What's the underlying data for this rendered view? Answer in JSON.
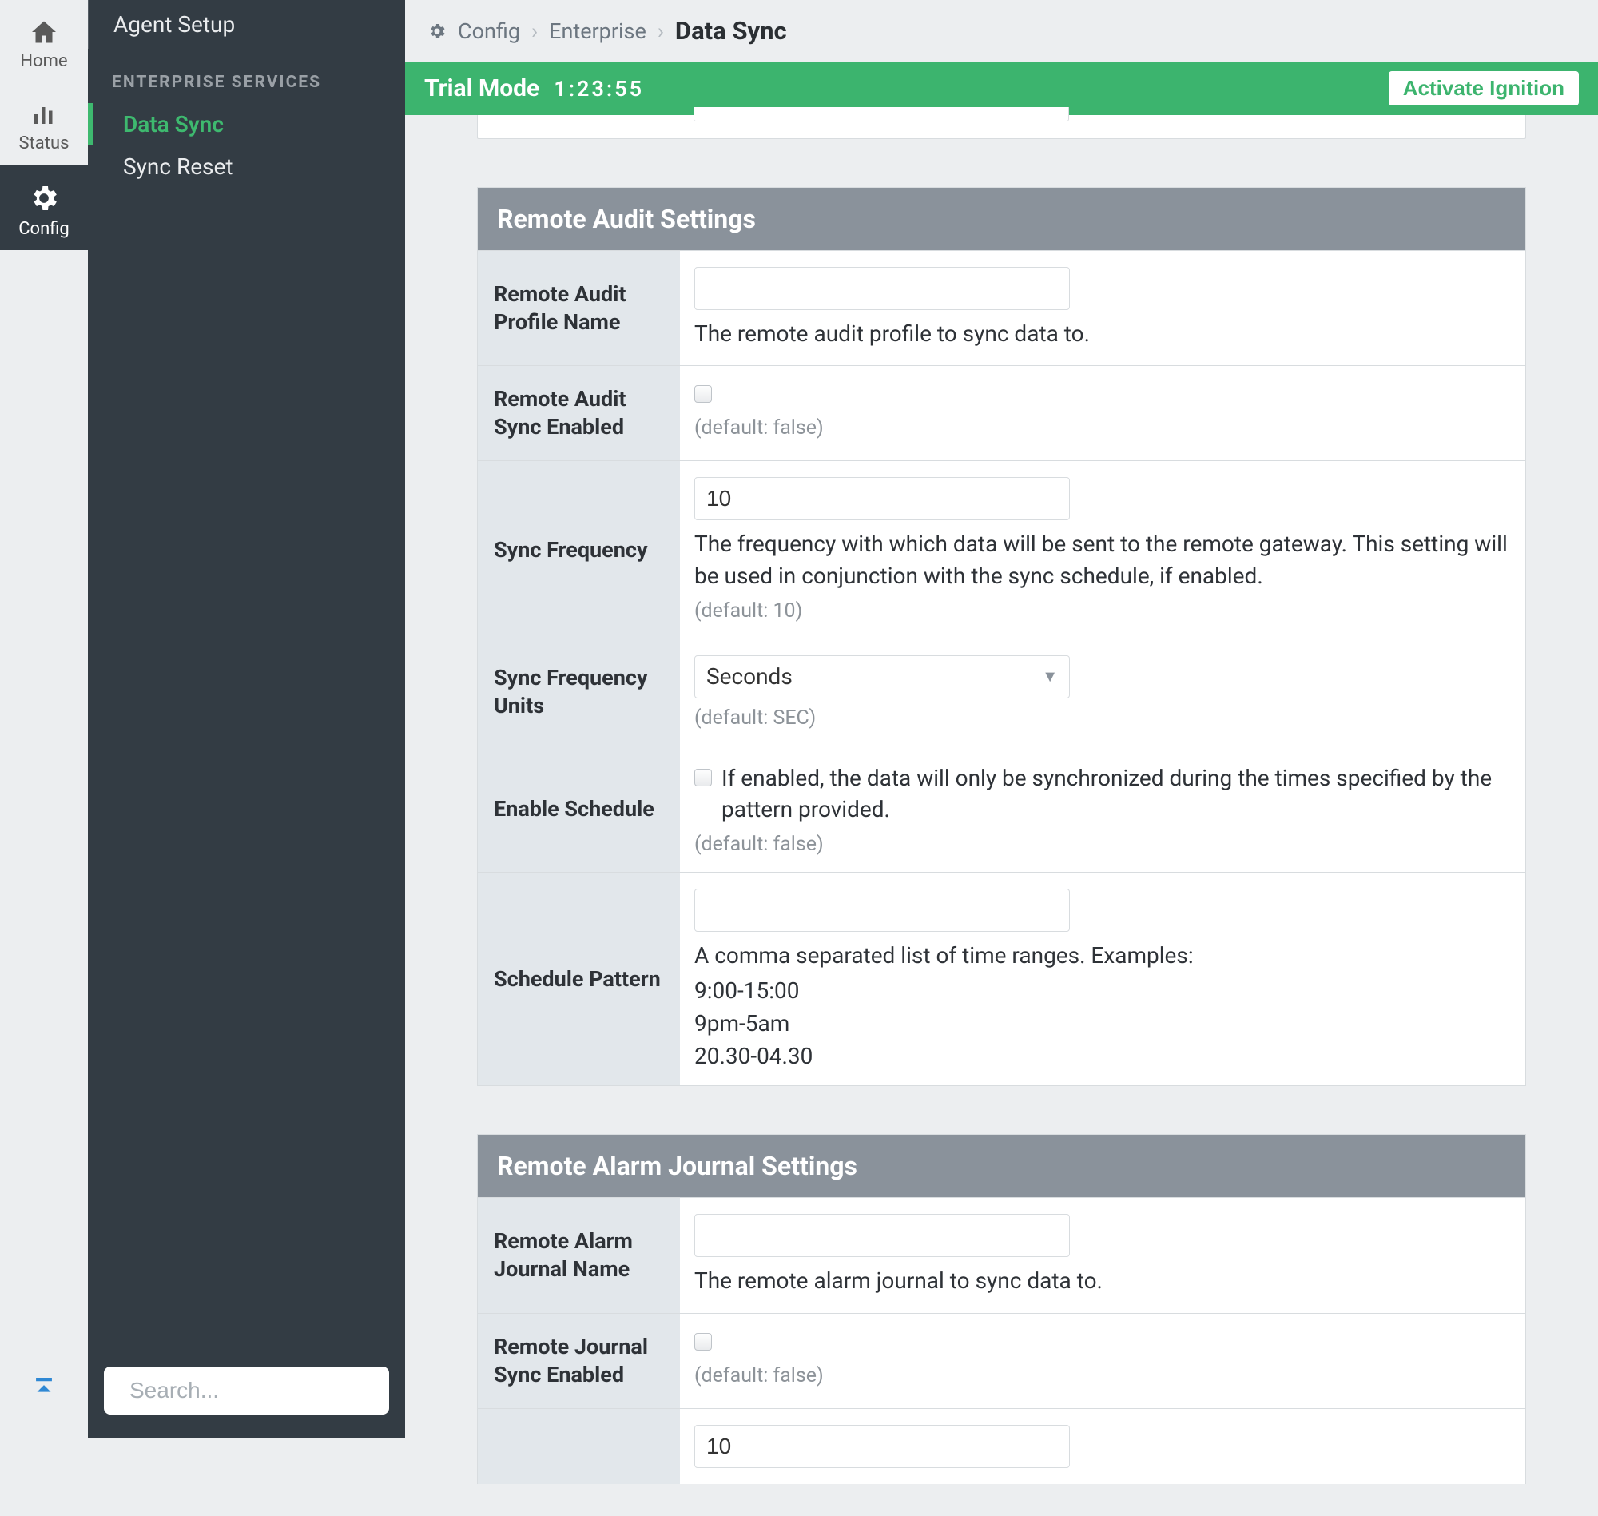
{
  "rail": {
    "home": "Home",
    "status": "Status",
    "config": "Config"
  },
  "sidebar": {
    "top_item": "Agent Setup",
    "section_title": "ENTERPRISE SERVICES",
    "items": [
      {
        "label": "Data Sync"
      },
      {
        "label": "Sync Reset"
      }
    ],
    "search_placeholder": "Search..."
  },
  "breadcrumb": {
    "c1": "Config",
    "c2": "Enterprise",
    "c3": "Data Sync"
  },
  "trial": {
    "label": "Trial Mode",
    "timer": "1:23:55",
    "activate": "Activate Ignition"
  },
  "panels": {
    "audit": {
      "title": "Remote Audit Settings",
      "profile_name_label": "Remote Audit Profile Name",
      "profile_name_help": "The remote audit profile to sync data to.",
      "sync_enabled_label": "Remote Audit Sync Enabled",
      "sync_enabled_default": "(default: false)",
      "freq_label": "Sync Frequency",
      "freq_value": "10",
      "freq_help": "The frequency with which data will be sent to the remote gateway. This setting will be used in conjunction with the sync schedule, if enabled.",
      "freq_default": "(default: 10)",
      "freq_units_label": "Sync Frequency Units",
      "freq_units_value": "Seconds",
      "freq_units_default": "(default: SEC)",
      "enable_sched_label": "Enable Schedule",
      "enable_sched_help": "If enabled, the data will only be synchronized during the times specified by the pattern provided.",
      "enable_sched_default": "(default: false)",
      "pattern_label": "Schedule Pattern",
      "pattern_help": "A comma separated list of time ranges. Examples:",
      "pattern_ex1": "9:00-15:00",
      "pattern_ex2": "9pm-5am",
      "pattern_ex3": "20.30-04.30"
    },
    "journal": {
      "title": "Remote Alarm Journal Settings",
      "name_label": "Remote Alarm Journal Name",
      "name_help": "The remote alarm journal to sync data to.",
      "sync_enabled_label": "Remote Journal Sync Enabled",
      "sync_enabled_default": "(default: false)",
      "freq_value": "10"
    }
  }
}
